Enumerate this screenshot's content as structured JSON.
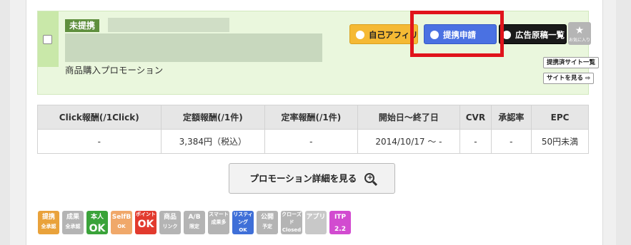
{
  "promotion": {
    "status_badge": "未提携",
    "type": "商品購入プロモーション"
  },
  "actions": {
    "self_affiliate": "自己アフィリエイト",
    "apply": "提携申請",
    "ad_list": "広告原稿一覧",
    "favorite_sub": "お気に入り",
    "partner_sites": "提携済サイト一覧",
    "view_site": "サイトを見る"
  },
  "colors": {
    "highlight": "#e0141b",
    "apply_blue": "#4a71e2",
    "self_yellow": "#f5b934",
    "header_green": "#eaf7dd"
  },
  "table": {
    "headers": [
      "Click報酬(/1Click)",
      "定額報酬(/1件)",
      "定率報酬(/1件)",
      "開始日～終了日",
      "CVR",
      "承認率",
      "EPC"
    ],
    "row": [
      "-",
      "3,384円（税込）",
      "-",
      "2014/10/17 ～ -",
      "-",
      "-",
      "50円未満"
    ]
  },
  "detail_button": "プロモーション詳細を見る",
  "tags": [
    {
      "l1": "提携",
      "l2": "全承認",
      "color": "#e9a23b"
    },
    {
      "l1": "成果",
      "l2": "全承認",
      "color": "#b4b4b4"
    },
    {
      "l1": "本人",
      "l2": "OK",
      "color": "#3aa33a"
    },
    {
      "l1": "SelfB",
      "l2": "OK",
      "color": "#f0a86a"
    },
    {
      "l1": "ポイント",
      "l2": "OK",
      "color": "#e23a2e"
    },
    {
      "l1": "商品",
      "l2": "リンク",
      "color": "#b4b4b4"
    },
    {
      "l1": "A/B",
      "l2": "限定",
      "color": "#b4b4b4"
    },
    {
      "l1": "スマート",
      "l2": "成果多",
      "color": "#b4b4b4"
    },
    {
      "l1": "リスティング",
      "l2": "OK",
      "color": "#3f6fd8"
    },
    {
      "l1": "公開",
      "l2": "予定",
      "color": "#b4b4b4"
    },
    {
      "l1": "クローズド",
      "l2": "Closed",
      "color": "#b4b4b4"
    },
    {
      "l1": "アプリ",
      "l2": "",
      "color": "#c8c8c8"
    },
    {
      "l1": "ITP",
      "l2": "2.2",
      "color": "#d24bd0"
    }
  ]
}
